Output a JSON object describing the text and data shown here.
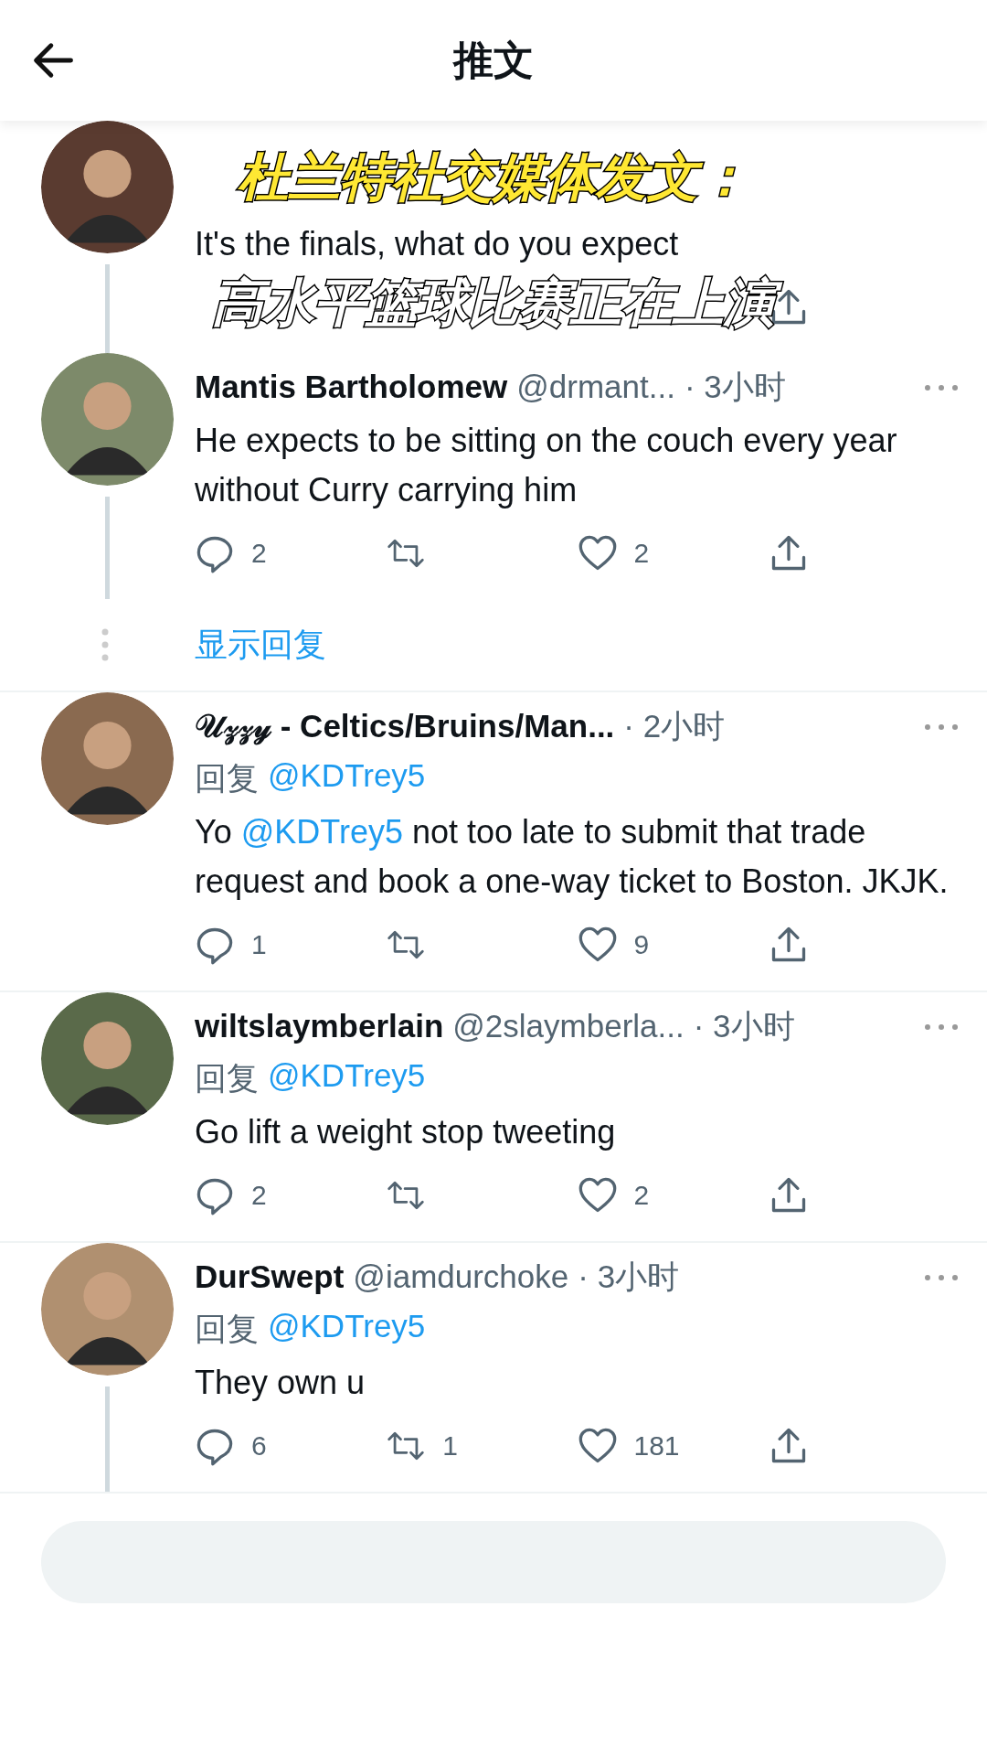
{
  "header": {
    "title": "推文"
  },
  "caption": {
    "lines": [
      "杜兰特社交媒体发文：",
      "高水平篮球比赛正在上演"
    ]
  },
  "tweets": [
    {
      "kind": "partial",
      "text": [
        {
          "kind": "plain",
          "text": "It's the finals, what do you expect"
        }
      ],
      "thread_line": true
    },
    {
      "kind": "full",
      "name": "Mantis Bartholomew",
      "handle": "@drmant...",
      "time": "· 3小时",
      "text": [
        {
          "kind": "plain",
          "text": "He expects to be sitting on the couch every year without Curry carrying him"
        }
      ],
      "replies": "2",
      "likes": "2",
      "thread_line": true,
      "show_replies": "显示回复"
    },
    {
      "kind": "full",
      "name": "𝒰𝓏𝓏𝓎 - Celtics/Bruins/Man...",
      "time": "· 2小时",
      "reply_label": "回复",
      "reply_to": "@KDTrey5",
      "text": [
        {
          "kind": "plain",
          "text": "Yo "
        },
        {
          "kind": "mention",
          "text": "@KDTrey5"
        },
        {
          "kind": "plain",
          "text": " not too late to submit that trade request and book a one-way ticket to Boston. JKJK."
        }
      ],
      "replies": "1",
      "likes": "9",
      "thread_line": false
    },
    {
      "kind": "full",
      "name": "wiltslaymberlain",
      "handle": "@2slaymberla...",
      "time": "· 3小时",
      "reply_label": "回复",
      "reply_to": "@KDTrey5",
      "text": [
        {
          "kind": "plain",
          "text": "Go lift a weight stop tweeting"
        }
      ],
      "replies": "2",
      "likes": "2",
      "thread_line": false
    },
    {
      "kind": "full",
      "name": "DurSwept",
      "handle": "@iamdurchoke",
      "time": "· 3小时",
      "reply_label": "回复",
      "reply_to": "@KDTrey5",
      "text": [
        {
          "kind": "plain",
          "text": "They own u"
        }
      ],
      "replies": "6",
      "retweets": "1",
      "likes": "181",
      "thread_line": true
    }
  ],
  "reply_bar": {
    "kind": "field"
  }
}
